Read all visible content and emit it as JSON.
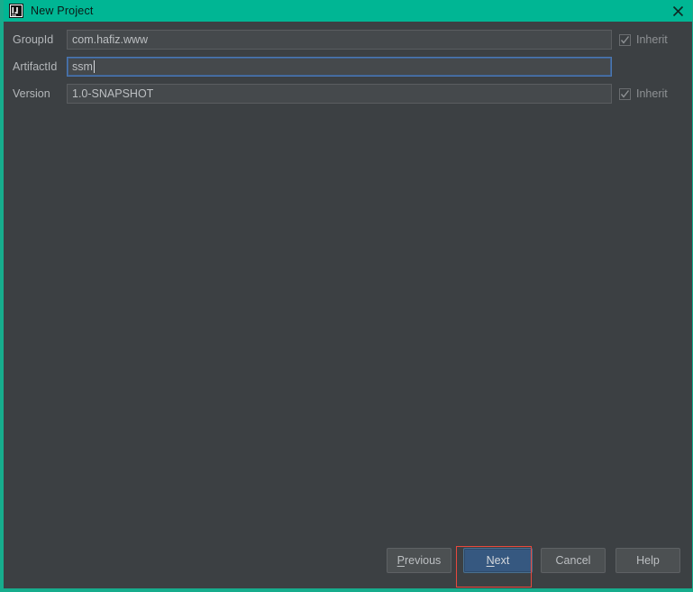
{
  "window": {
    "title": "New Project",
    "icon": "intellij-idea-logo-icon",
    "close_icon": "close-icon",
    "frame_color": "#17ad8d",
    "titlebar_color": "#00b694",
    "background_color": "#3c4043"
  },
  "form": {
    "rows": [
      {
        "label": "GroupId",
        "value": "com.hafiz.www",
        "focused": false,
        "has_caret": false,
        "inherit": {
          "label": "Inherit",
          "checked": true,
          "enabled": false
        }
      },
      {
        "label": "ArtifactId",
        "value": "ssm",
        "focused": true,
        "has_caret": true,
        "inherit": null
      },
      {
        "label": "Version",
        "value": "1.0-SNAPSHOT",
        "focused": false,
        "has_caret": false,
        "inherit": {
          "label": "Inherit",
          "checked": true,
          "enabled": false
        }
      }
    ]
  },
  "buttons": {
    "previous": {
      "label": "Previous",
      "mnemonic": "P",
      "primary": false
    },
    "next": {
      "label": "Next",
      "mnemonic": "N",
      "primary": true
    },
    "cancel": {
      "label": "Cancel",
      "mnemonic": "",
      "primary": false
    },
    "help": {
      "label": "Help",
      "mnemonic": "",
      "primary": false
    }
  },
  "annotation": {
    "highlight_target": "next-button",
    "color": "#e8483d"
  }
}
